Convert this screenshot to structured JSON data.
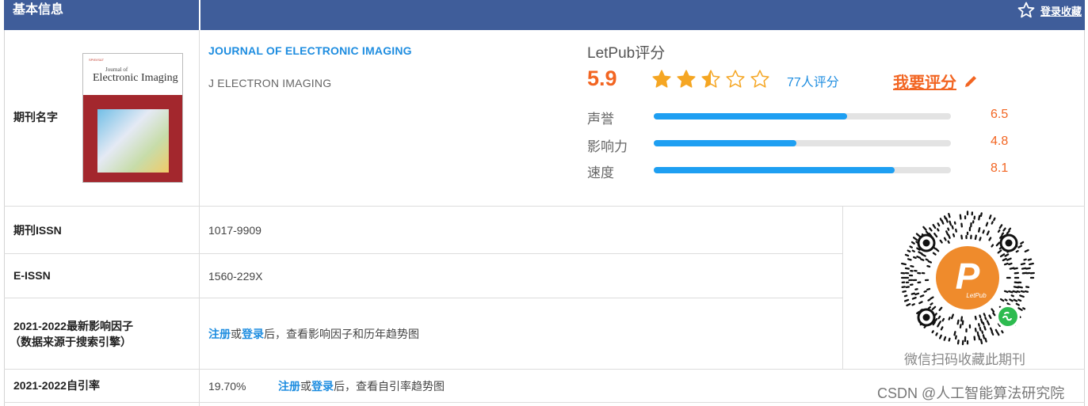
{
  "header": {
    "title": "基本信息",
    "favorite_label": "登录收藏"
  },
  "rows": {
    "name_label": "期刊名字",
    "issn_label": "期刊ISSN",
    "eissn_label": "E-ISSN",
    "if_label_line1": "2021-2022最新影响因子",
    "if_label_line2": "（数据来源于搜索引擎）",
    "self_cite_label": "2021-2022自引率"
  },
  "cover": {
    "tiny_text": "SPIE/IS&T",
    "journal_of": "Journal of",
    "title": "Electronic Imaging"
  },
  "journal": {
    "full_name": "JOURNAL OF ELECTRONIC IMAGING",
    "abbreviation": "J ELECTRON IMAGING",
    "issn": "1017-9909",
    "eissn": "1560-229X"
  },
  "impact_factor": {
    "register": "注册",
    "or": "或",
    "login": "登录",
    "suffix": "后，查看影响因子和历年趋势图"
  },
  "self_citation": {
    "value": "19.70%",
    "register": "注册",
    "or": "或",
    "login": "登录",
    "suffix": "后，查看自引率趋势图"
  },
  "rating": {
    "title": "LetPub评分",
    "score": "5.9",
    "stars": 2.5,
    "max_stars": 5,
    "count_label": "77人评分",
    "rate_button": "我要评分",
    "bars": [
      {
        "label": "声誉",
        "value": "6.5",
        "fraction": 0.65
      },
      {
        "label": "影响力",
        "value": "4.8",
        "fraction": 0.48
      },
      {
        "label": "速度",
        "value": "8.1",
        "fraction": 0.81
      }
    ]
  },
  "qr": {
    "caption": "微信扫码收藏此期刊",
    "logo_letter": "P",
    "logo_text": "LetPub"
  },
  "watermark": "CSDN @人工智能算法研究院",
  "colors": {
    "header_bg": "#3f5d9a",
    "link_blue": "#1e8de0",
    "accent_orange": "#f26522",
    "bar_blue": "#1e9ff2",
    "star_gold": "#f5a623"
  },
  "icons": {
    "favorite": "star-outline-icon",
    "rate": "pencil-icon",
    "wechat": "wechat-mini-program-icon"
  }
}
